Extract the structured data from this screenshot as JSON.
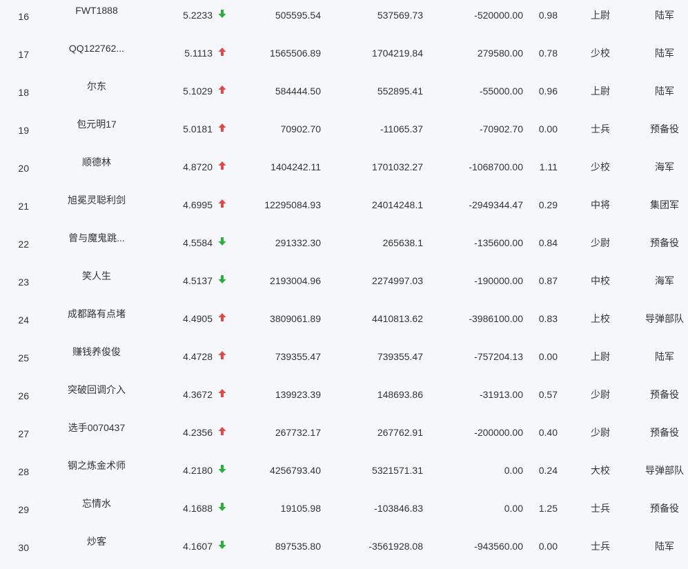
{
  "colors": {
    "up": "#e84545",
    "down": "#27b03a",
    "text": "#333333",
    "background": "#f5f7fa"
  },
  "rows": [
    {
      "rank": "16",
      "name": "FWT1888",
      "score": "5.2233",
      "trend": "down",
      "trend_icon": "arrow-down-icon",
      "value1": "505595.54",
      "value2": "537569.73",
      "value3": "-520000.00",
      "ratio": "0.98",
      "military_rank": "上尉",
      "branch": "陆军"
    },
    {
      "rank": "17",
      "name": "QQ122762...",
      "score": "5.1113",
      "trend": "up",
      "trend_icon": "arrow-up-icon",
      "value1": "1565506.89",
      "value2": "1704219.84",
      "value3": "279580.00",
      "ratio": "0.78",
      "military_rank": "少校",
      "branch": "陆军"
    },
    {
      "rank": "18",
      "name": "尔东",
      "score": "5.1029",
      "trend": "up",
      "trend_icon": "arrow-up-icon",
      "value1": "584444.50",
      "value2": "552895.41",
      "value3": "-55000.00",
      "ratio": "0.96",
      "military_rank": "上尉",
      "branch": "陆军"
    },
    {
      "rank": "19",
      "name": "包元明17",
      "score": "5.0181",
      "trend": "up",
      "trend_icon": "arrow-up-icon",
      "value1": "70902.70",
      "value2": "-11065.37",
      "value3": "-70902.70",
      "ratio": "0.00",
      "military_rank": "士兵",
      "branch": "预备役"
    },
    {
      "rank": "20",
      "name": "顺德林",
      "score": "4.8720",
      "trend": "up",
      "trend_icon": "arrow-up-icon",
      "value1": "1404242.11",
      "value2": "1701032.27",
      "value3": "-1068700.00",
      "ratio": "1.11",
      "military_rank": "少校",
      "branch": "海军"
    },
    {
      "rank": "21",
      "name": "旭冕灵聪利剑",
      "score": "4.6995",
      "trend": "up",
      "trend_icon": "arrow-up-icon",
      "value1": "12295084.93",
      "value2": "24014248.1",
      "value3": "-2949344.47",
      "ratio": "0.29",
      "military_rank": "中将",
      "branch": "集团军"
    },
    {
      "rank": "22",
      "name": "曾与魔鬼跳...",
      "score": "4.5584",
      "trend": "down",
      "trend_icon": "arrow-down-icon",
      "value1": "291332.30",
      "value2": "265638.1",
      "value3": "-135600.00",
      "ratio": "0.84",
      "military_rank": "少尉",
      "branch": "预备役"
    },
    {
      "rank": "23",
      "name": "笑人生",
      "score": "4.5137",
      "trend": "down",
      "trend_icon": "arrow-down-icon",
      "value1": "2193004.96",
      "value2": "2274997.03",
      "value3": "-190000.00",
      "ratio": "0.87",
      "military_rank": "中校",
      "branch": "海军"
    },
    {
      "rank": "24",
      "name": "成都路有点堵",
      "score": "4.4905",
      "trend": "up",
      "trend_icon": "arrow-up-icon",
      "value1": "3809061.89",
      "value2": "4410813.62",
      "value3": "-3986100.00",
      "ratio": "0.83",
      "military_rank": "上校",
      "branch": "导弹部队"
    },
    {
      "rank": "25",
      "name": "赚钱养俊俊",
      "score": "4.4728",
      "trend": "up",
      "trend_icon": "arrow-up-icon",
      "value1": "739355.47",
      "value2": "739355.47",
      "value3": "-757204.13",
      "ratio": "0.00",
      "military_rank": "上尉",
      "branch": "陆军"
    },
    {
      "rank": "26",
      "name": "突破回调介入",
      "score": "4.3672",
      "trend": "up",
      "trend_icon": "arrow-up-icon",
      "value1": "139923.39",
      "value2": "148693.86",
      "value3": "-31913.00",
      "ratio": "0.57",
      "military_rank": "少尉",
      "branch": "预备役"
    },
    {
      "rank": "27",
      "name": "选手0070437",
      "score": "4.2356",
      "trend": "up",
      "trend_icon": "arrow-up-icon",
      "value1": "267732.17",
      "value2": "267762.91",
      "value3": "-200000.00",
      "ratio": "0.40",
      "military_rank": "少尉",
      "branch": "预备役"
    },
    {
      "rank": "28",
      "name": "钢之炼金术师",
      "score": "4.2180",
      "trend": "down",
      "trend_icon": "arrow-down-icon",
      "value1": "4256793.40",
      "value2": "5321571.31",
      "value3": "0.00",
      "ratio": "0.24",
      "military_rank": "大校",
      "branch": "导弹部队"
    },
    {
      "rank": "29",
      "name": "忘情水",
      "score": "4.1688",
      "trend": "down",
      "trend_icon": "arrow-down-icon",
      "value1": "19105.98",
      "value2": "-103846.83",
      "value3": "0.00",
      "ratio": "1.25",
      "military_rank": "士兵",
      "branch": "预备役"
    },
    {
      "rank": "30",
      "name": "炒客",
      "score": "4.1607",
      "trend": "down",
      "trend_icon": "arrow-down-icon",
      "value1": "897535.80",
      "value2": "-3561928.08",
      "value3": "-943560.00",
      "ratio": "0.00",
      "military_rank": "士兵",
      "branch": "陆军"
    }
  ]
}
